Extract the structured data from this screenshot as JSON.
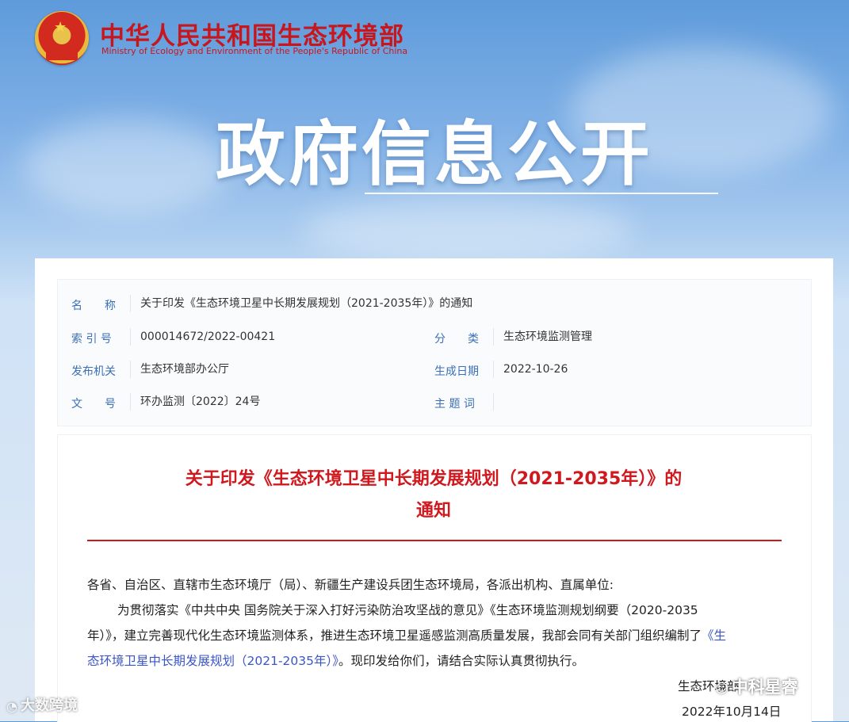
{
  "header": {
    "ministry_cn": "中华人民共和国生态环境部",
    "ministry_en": "Ministry of Ecology and Environment of the People's Republic of China",
    "banner_title": "政府信息公开"
  },
  "meta": {
    "name_label": "名　　称",
    "name_value": "关于印发《生态环境卫星中长期发展规划（2021-2035年）》的通知",
    "index_label": "索 引 号",
    "index_value": "000014672/2022-00421",
    "category_label": "分　　类",
    "category_value": "生态环境监测管理",
    "issuer_label": "发布机关",
    "issuer_value": "生态环境部办公厅",
    "date_label": "生成日期",
    "date_value": "2022-10-26",
    "docno_label": "文　　号",
    "docno_value": "环办监测〔2022〕24号",
    "keywords_label": "主 题 词",
    "keywords_value": ""
  },
  "document": {
    "title_line1": "关于印发《生态环境卫星中长期发展规划（2021-2035年）》的",
    "title_line2": "通知",
    "addressee": "各省、自治区、直辖市生态环境厅（局）、新疆生产建设兵团生态环境局，各派出机构、直属单位:",
    "para1_line1": "为贯彻落实《中共中央 国务院关于深入打好污染防治攻坚战的意见》《生态环境监测规划纲要（2020-2035",
    "para1_line2_text": "年）》，建立完善现代化生态环境监测体系，推进生态环境卫星遥感监测高质量发展，我部会同有关部门组织编制了",
    "para1_line2_link": "《生",
    "para1_line3_link": "态环境卫星中长期发展规划（2021-2035年）》",
    "para1_line3_text": "。现印发给你们，请结合实际认真贯彻执行。",
    "signature_org": "生态环境部",
    "signature_date": "2022年10月14日"
  },
  "watermarks": {
    "left": "大数跨境",
    "right": "中科星睿"
  }
}
